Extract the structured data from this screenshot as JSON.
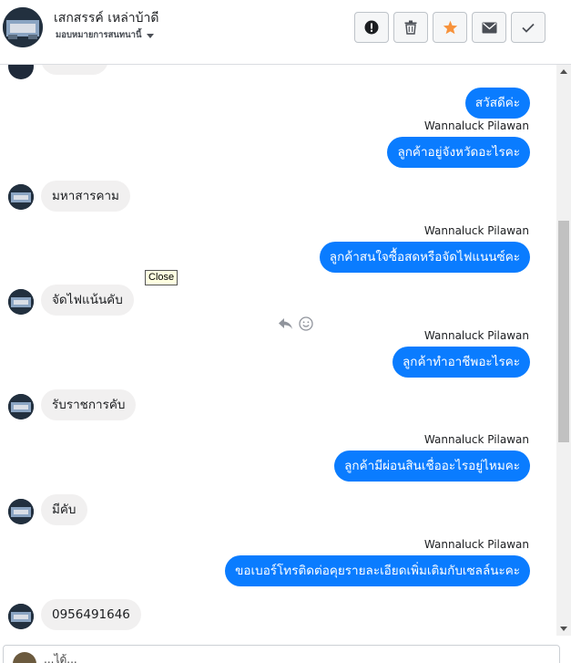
{
  "header": {
    "name": "เสกสรรค์ เหล่าบ้าดี",
    "subtitle": "มอบหมายการสนทนานี้",
    "actions": [
      {
        "name": "report-button",
        "icon": "exclamation-icon"
      },
      {
        "name": "delete-button",
        "icon": "trash-icon"
      },
      {
        "name": "star-button",
        "icon": "star-icon"
      },
      {
        "name": "mail-button",
        "icon": "envelope-icon"
      },
      {
        "name": "done-button",
        "icon": "check-icon"
      }
    ]
  },
  "colors": {
    "outgoing_bubble": "#0a7cff",
    "incoming_bubble": "#f1f0f0",
    "star": "#f7923b"
  },
  "thread": {
    "messages": [
      {
        "direction": "in",
        "text": ""
      },
      {
        "direction": "out",
        "text": "สวัสดีค่ะ"
      },
      {
        "direction": "out",
        "sender": "Wannaluck Pilawan",
        "text": "ลูกค้าอยู่จังหวัดอะไรคะ"
      },
      {
        "direction": "in",
        "text": "มหาสารคาม"
      },
      {
        "direction": "out",
        "sender": "Wannaluck Pilawan",
        "text": "ลูกค้าสนใจซื้อสดหรือจัดไฟแนนซ์คะ"
      },
      {
        "direction": "in",
        "text": "จัดไฟแน้นคับ"
      },
      {
        "direction": "out",
        "sender": "Wannaluck Pilawan",
        "text": "ลูกค้าทำอาชีพอะไรคะ"
      },
      {
        "direction": "in",
        "text": "รับราชการคับ"
      },
      {
        "direction": "out",
        "sender": "Wannaluck Pilawan",
        "text": "ลูกค้ามีผ่อนสินเชื่ออะไรอยู่ไหมคะ"
      },
      {
        "direction": "in",
        "text": "มีคับ"
      },
      {
        "direction": "out",
        "sender": "Wannaluck Pilawan",
        "text": "ขอเบอร์โทรติดต่อคุยรายละเอียดเพิ่มเติมกับเซลล์นะคะ"
      },
      {
        "direction": "in",
        "text": "0956491646"
      }
    ]
  },
  "tooltip": "Close",
  "composer": {
    "text": "...ได้..."
  }
}
